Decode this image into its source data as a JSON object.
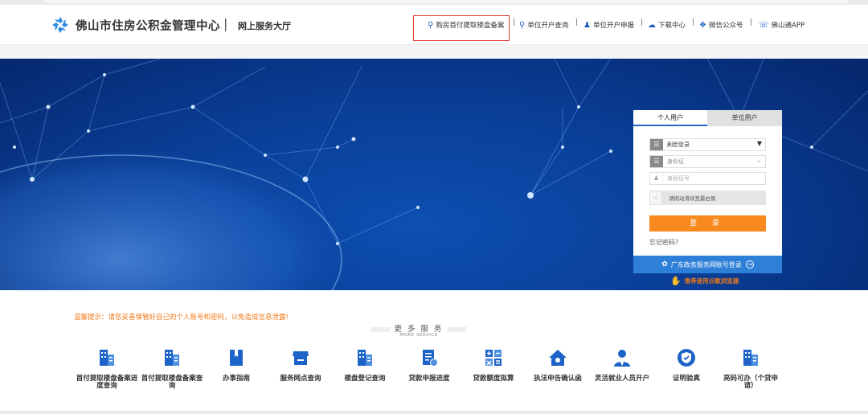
{
  "header": {
    "brand": "佛山市住房公积金管理中心",
    "sub_brand": "网上服务大厅",
    "nav": [
      {
        "label": "购房首付提取楼盘备案",
        "icon": "search-icon"
      },
      {
        "label": "单位开户查询",
        "icon": "search-icon"
      },
      {
        "label": "单位开户申报",
        "icon": "user-icon"
      },
      {
        "label": "下载中心",
        "icon": "cloud-download-icon"
      },
      {
        "label": "微信公众号",
        "icon": "wechat-icon"
      },
      {
        "label": "佛山通APP",
        "icon": "phone-icon"
      }
    ]
  },
  "login": {
    "tab_personal": "个人用户",
    "tab_company": "单位用户",
    "method_value": "刷脸登录",
    "id_type_placeholder": "身份证",
    "id_number_placeholder": "身份证号",
    "slider_text": "请拖动滑块至最右侧",
    "login_button": "登 录",
    "forgot": "忘记密码?",
    "gd_login": "广东政务服务网账号登录",
    "recommend": "推荐使用谷歌浏览器"
  },
  "notice": "温馨提示：请您妥善保管好自己的个人账号和密码，以免造成信息泄露!",
  "more_services": {
    "title": "更 多 服 务",
    "subtitle": "MORE SERVICE",
    "items": [
      {
        "label": "首付提取楼盘备案进度查询",
        "icon": "building-icon"
      },
      {
        "label": "首付提取楼盘备案查询",
        "icon": "building-icon"
      },
      {
        "label": "办事指南",
        "icon": "book-icon"
      },
      {
        "label": "服务网点查询",
        "icon": "store-icon"
      },
      {
        "label": "楼盘登记查询",
        "icon": "building-icon"
      },
      {
        "label": "贷款申报进度",
        "icon": "document-icon"
      },
      {
        "label": "贷款额度拟算",
        "icon": "calculator-icon"
      },
      {
        "label": "执法申告确认函",
        "icon": "home-icon"
      },
      {
        "label": "灵活就业人员开户",
        "icon": "person-icon"
      },
      {
        "label": "证明验真",
        "icon": "shield-check-icon"
      },
      {
        "label": "亮码可办（个贷申请）",
        "icon": "building-icon"
      }
    ]
  },
  "colors": {
    "brand_blue": "#1b5fbf",
    "accent_orange": "#f7891f",
    "highlight_red": "#e53935",
    "gd_blue": "#2e7fd8"
  }
}
